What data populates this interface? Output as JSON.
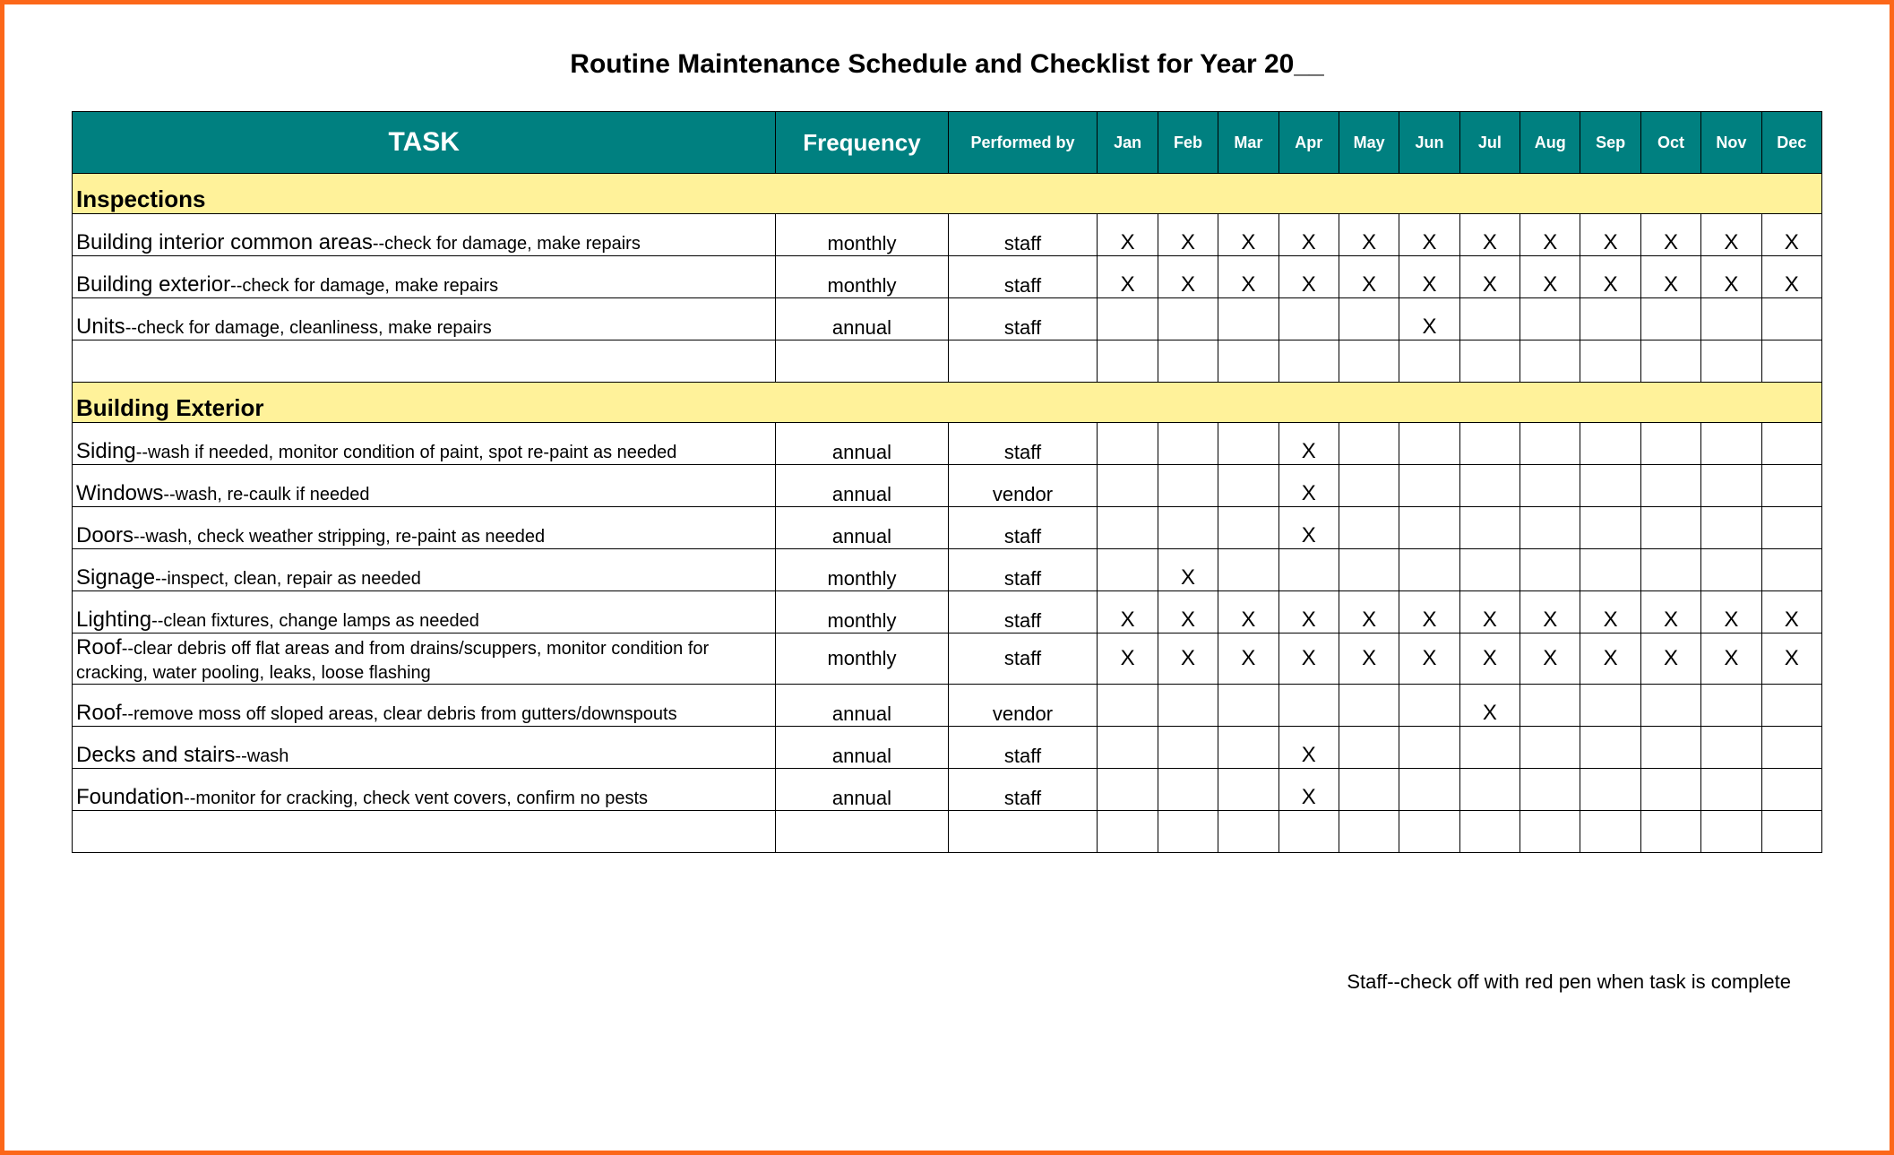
{
  "title": "Routine Maintenance Schedule and Checklist for Year 20__",
  "headers": {
    "task": "TASK",
    "frequency": "Frequency",
    "performed_by": "Performed by",
    "months": [
      "Jan",
      "Feb",
      "Mar",
      "Apr",
      "May",
      "Jun",
      "Jul",
      "Aug",
      "Sep",
      "Oct",
      "Nov",
      "Dec"
    ]
  },
  "mark": "X",
  "sections": [
    {
      "name": "Inspections",
      "rows": [
        {
          "task_bold": "Building interior common areas",
          "task_desc": "--check for damage, make repairs",
          "frequency": "monthly",
          "performed_by": "staff",
          "months": [
            1,
            1,
            1,
            1,
            1,
            1,
            1,
            1,
            1,
            1,
            1,
            1
          ]
        },
        {
          "task_bold": "Building exterior",
          "task_desc": "--check for damage, make repairs",
          "frequency": "monthly",
          "performed_by": "staff",
          "months": [
            1,
            1,
            1,
            1,
            1,
            1,
            1,
            1,
            1,
            1,
            1,
            1
          ]
        },
        {
          "task_bold": "Units",
          "task_desc": "--check for damage, cleanliness, make repairs",
          "frequency": "annual",
          "performed_by": "staff",
          "months": [
            0,
            0,
            0,
            0,
            0,
            1,
            0,
            0,
            0,
            0,
            0,
            0
          ]
        },
        {
          "blank": true
        }
      ]
    },
    {
      "name": "Building Exterior",
      "rows": [
        {
          "task_bold": "Siding",
          "task_desc": "--wash if needed, monitor condition of paint, spot re-paint as needed",
          "frequency": "annual",
          "performed_by": "staff",
          "months": [
            0,
            0,
            0,
            1,
            0,
            0,
            0,
            0,
            0,
            0,
            0,
            0
          ]
        },
        {
          "task_bold": "Windows",
          "task_desc": "--wash, re-caulk if needed",
          "frequency": "annual",
          "performed_by": "vendor",
          "months": [
            0,
            0,
            0,
            1,
            0,
            0,
            0,
            0,
            0,
            0,
            0,
            0
          ]
        },
        {
          "task_bold": "Doors",
          "task_desc": "--wash, check weather stripping, re-paint as needed",
          "frequency": "annual",
          "performed_by": "staff",
          "months": [
            0,
            0,
            0,
            1,
            0,
            0,
            0,
            0,
            0,
            0,
            0,
            0
          ]
        },
        {
          "task_bold": "Signage",
          "task_desc": "--inspect, clean, repair as needed",
          "frequency": "monthly",
          "performed_by": "staff",
          "months": [
            0,
            1,
            0,
            0,
            0,
            0,
            0,
            0,
            0,
            0,
            0,
            0
          ]
        },
        {
          "task_bold": "Lighting",
          "task_desc": "--clean fixtures, change lamps as needed",
          "frequency": "monthly",
          "performed_by": "staff",
          "months": [
            1,
            1,
            1,
            1,
            1,
            1,
            1,
            1,
            1,
            1,
            1,
            1
          ]
        },
        {
          "task_bold": "Roof",
          "task_desc": "--clear debris off flat areas and from drains/scuppers, monitor condition for cracking, water pooling, leaks, loose flashing",
          "frequency": "monthly",
          "performed_by": "staff",
          "months": [
            1,
            1,
            1,
            1,
            1,
            1,
            1,
            1,
            1,
            1,
            1,
            1
          ],
          "tall": true
        },
        {
          "task_bold": "Roof",
          "task_desc": "--remove moss off sloped areas, clear debris from gutters/downspouts",
          "frequency": "annual",
          "performed_by": "vendor",
          "months": [
            0,
            0,
            0,
            0,
            0,
            0,
            1,
            0,
            0,
            0,
            0,
            0
          ]
        },
        {
          "task_bold": "Decks and stairs",
          "task_desc": "--wash",
          "frequency": "annual",
          "performed_by": "staff",
          "months": [
            0,
            0,
            0,
            1,
            0,
            0,
            0,
            0,
            0,
            0,
            0,
            0
          ]
        },
        {
          "task_bold": "Foundation",
          "task_desc": "--monitor for cracking, check vent covers, confirm no pests",
          "frequency": "annual",
          "performed_by": "staff",
          "months": [
            0,
            0,
            0,
            1,
            0,
            0,
            0,
            0,
            0,
            0,
            0,
            0
          ]
        },
        {
          "blank": true
        }
      ]
    }
  ],
  "footer_note": "Staff--check off with red pen when task is complete"
}
